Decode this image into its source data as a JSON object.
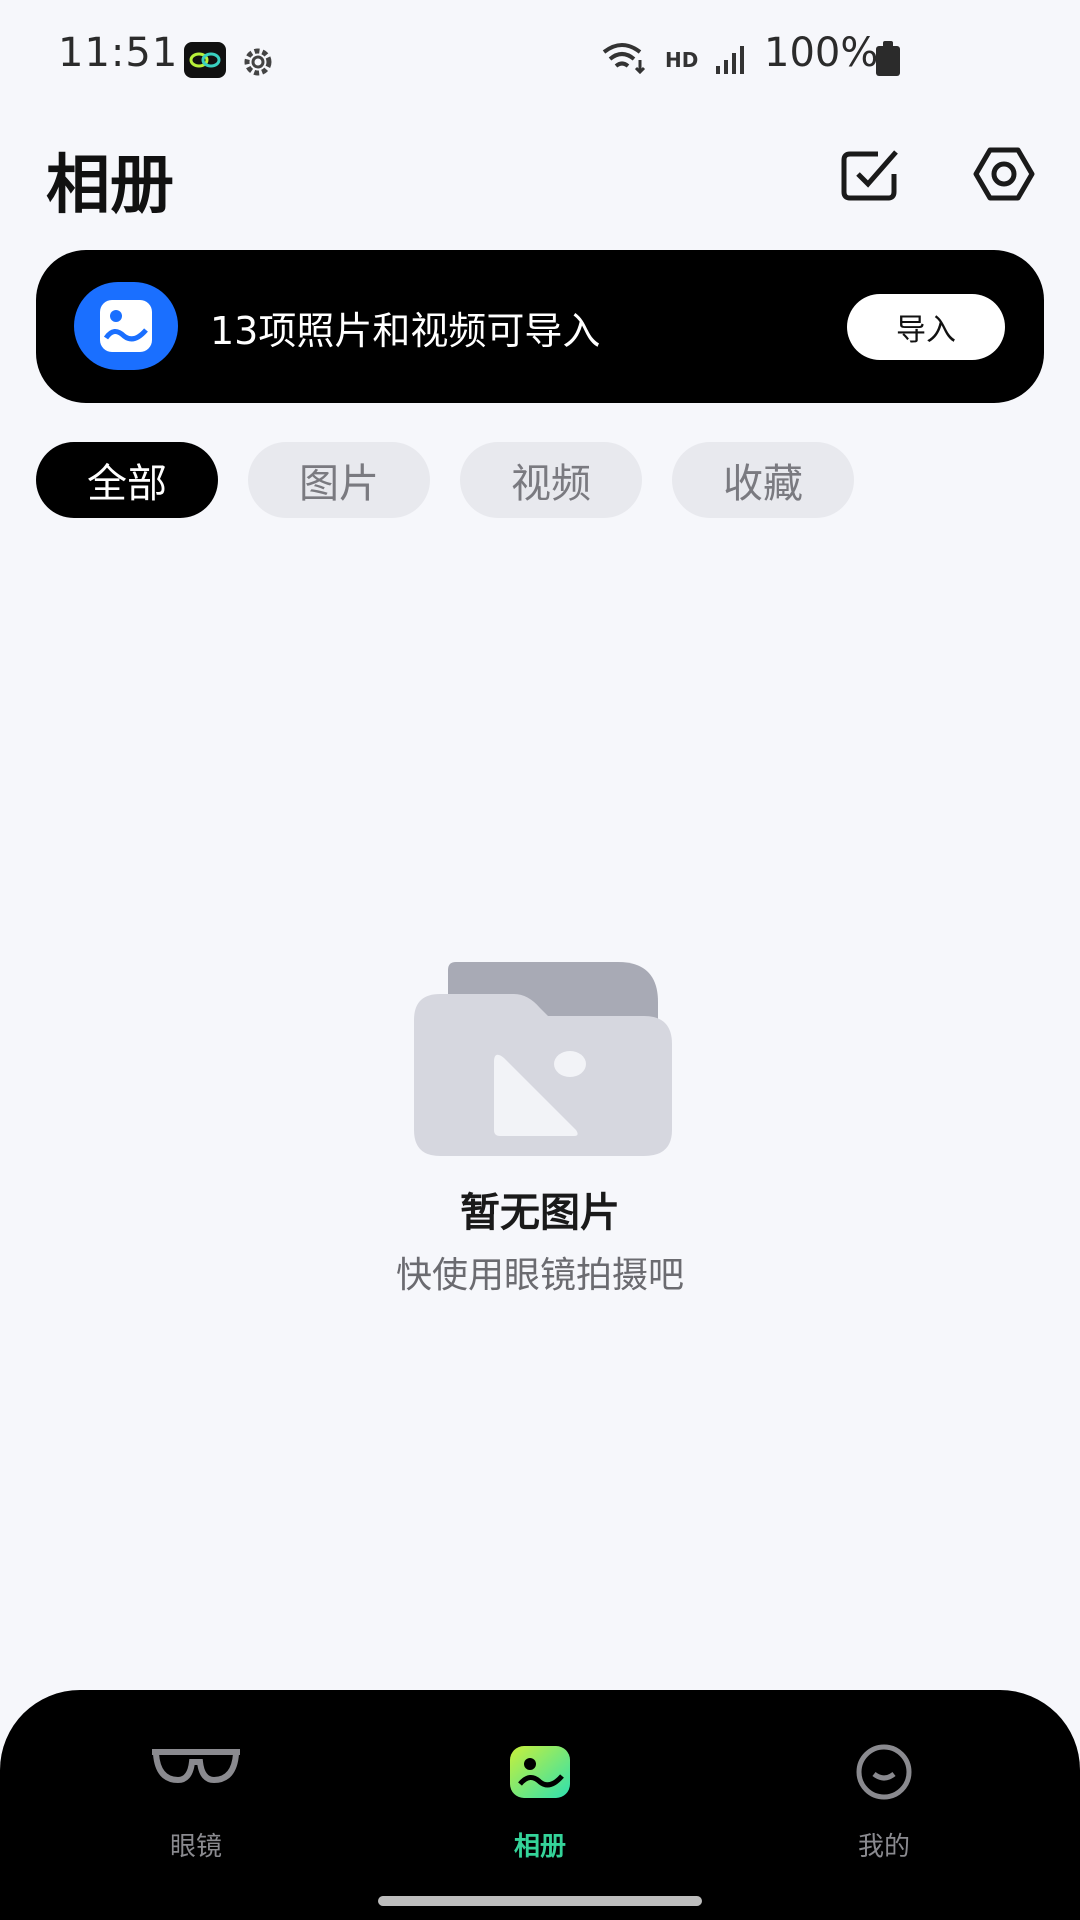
{
  "status_bar": {
    "time": "11:51",
    "network": "HD",
    "battery": "100%"
  },
  "header": {
    "title": "相册"
  },
  "import_banner": {
    "text": "13项照片和视频可导入",
    "button_label": "导入",
    "icon_color": "#1a6fff"
  },
  "filters": [
    {
      "label": "全部",
      "active": true
    },
    {
      "label": "图片",
      "active": false
    },
    {
      "label": "视频",
      "active": false
    },
    {
      "label": "收藏",
      "active": false
    }
  ],
  "empty_state": {
    "title": "暂无图片",
    "subtitle": "快使用眼镜拍摄吧"
  },
  "bottom_nav": {
    "items": [
      {
        "label": "眼镜",
        "icon": "glasses-icon",
        "active": false
      },
      {
        "label": "相册",
        "icon": "album-icon",
        "active": true
      },
      {
        "label": "我的",
        "icon": "smiley-icon",
        "active": false
      }
    ],
    "active_color": "#34d399"
  }
}
